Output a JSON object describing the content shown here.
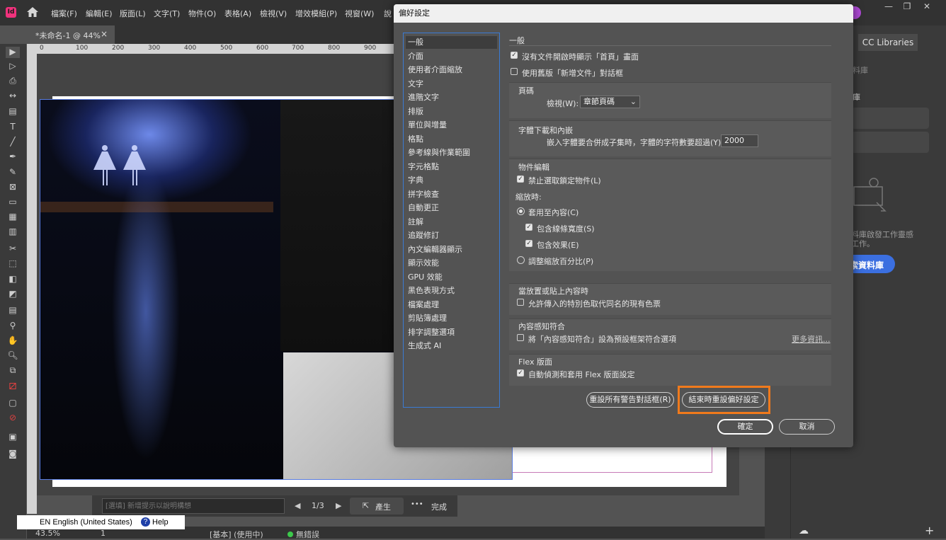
{
  "app": {
    "logo": "Id",
    "menu": [
      "檔案(F)",
      "編輯(E)",
      "版面(L)",
      "文字(T)",
      "物件(O)",
      "表格(A)",
      "檢視(V)",
      "增效模組(P)",
      "視窗(W)",
      "說"
    ]
  },
  "document": {
    "tab_title": "*未命名-1 @ 44%",
    "ruler_ticks": [
      "0",
      "100",
      "200",
      "300",
      "400",
      "500",
      "600",
      "700",
      "800",
      "900"
    ]
  },
  "prompt_bar": {
    "placeholder": "[選填] 新增提示以說明構想",
    "page_counter": "1/3",
    "generate_label": "產生",
    "more": "•••",
    "done_label": "完成"
  },
  "status_bar": {
    "zoom": "43.5%",
    "page": "1",
    "profile": "[基本] (使用中)",
    "preflight": "無錯誤"
  },
  "language_bar": {
    "lang": "EN English (United States)",
    "help": "Help"
  },
  "right_panel": {
    "tab": "CC Libraries",
    "fragment_1": "料庫",
    "fragment_2": "庫",
    "fragment_3": "的資料庫啟發工作靈感",
    "fragment_4": "加速工作。",
    "fragment_button": "索資料庫"
  },
  "dialog": {
    "title": "偏好設定",
    "categories": [
      "一般",
      "介面",
      "使用者介面縮放",
      "文字",
      "進階文字",
      "排版",
      "單位與增量",
      "格點",
      "參考線與作業範圍",
      "字元格點",
      "字典",
      "拼字檢查",
      "自動更正",
      "註解",
      "追蹤修訂",
      "內文編輯器顯示",
      "顯示效能",
      "GPU 效能",
      "黑色表現方式",
      "檔案處理",
      "剪貼簿處理",
      "排字調整選項",
      "生成式 AI"
    ],
    "selected_category": "一般",
    "heading": "一般",
    "opt_show_home": "沒有文件開啟時顯示「首頁」畫面",
    "opt_legacy_new_doc": "使用舊版「新增文件」對話框",
    "page_numbering": {
      "title": "頁碼",
      "view_label": "檢視(W):",
      "view_value": "章節頁碼"
    },
    "font_download": {
      "title": "字體下載和內嵌",
      "subset_label": "嵌入字體要合併成子集時，字體的字符數要超過(Y):",
      "subset_value": "2000"
    },
    "object_editing": {
      "title": "物件編輯",
      "prevent_locked": "禁止選取鎖定物件(L)",
      "when_scaling": "縮放時:",
      "apply_to_content": "套用至內容(C)",
      "include_stroke": "包含線條寬度(S)",
      "include_effects": "包含效果(E)",
      "adjust_percentage": "調整縮放百分比(P)"
    },
    "paste": {
      "title": "當放置或貼上內容時",
      "allow_spot": "允許傳入的特別色取代同名的現有色票"
    },
    "content_aware": {
      "title": "內容感知符合",
      "set_default": "將「內容感知符合」設為預設框架符合選項",
      "more_info": "更多資訊..."
    },
    "flex": {
      "title": "Flex 版面",
      "auto_detect": "自動偵測和套用 Flex 版面設定"
    },
    "btn_reset_warnings": "重設所有警告對話框(R)",
    "btn_reset_prefs": "結束時重設偏好設定",
    "btn_ok": "確定",
    "btn_cancel": "取消",
    "highlight_color": "#f07a1c"
  }
}
